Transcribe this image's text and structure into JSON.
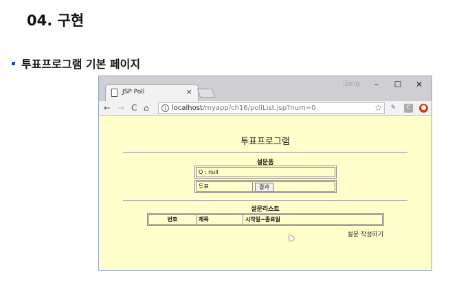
{
  "slide": {
    "title": "04. 구현",
    "bullet": "투표프로그램 기본 페이지"
  },
  "browser": {
    "tab_title": "JSP Poll",
    "tab_close": "×",
    "user": "DJung",
    "minimize": "–",
    "maximize": "☐",
    "close": "✕",
    "back": "←",
    "forward": "→",
    "reload": "C",
    "home": "⌂",
    "info": "i",
    "url_host": "localhost",
    "url_path": "/myapp/ch16/pollList.jsp?num=0",
    "star": "☆",
    "ext_feather": "✎",
    "ext_c": "C",
    "ext_ublock": "●"
  },
  "page": {
    "heading": "투표프로그램",
    "poll_form_label": "설문폼",
    "question": "Q : null",
    "vote_label": "투표",
    "result_button": "결과",
    "list_label": "설문리스트",
    "columns": [
      "번호",
      "제목",
      "시작일~종료일"
    ],
    "create_link": "설문 작성하기"
  },
  "colors": {
    "page_bg": "#ffffcc",
    "bullet": "#2244cc"
  }
}
